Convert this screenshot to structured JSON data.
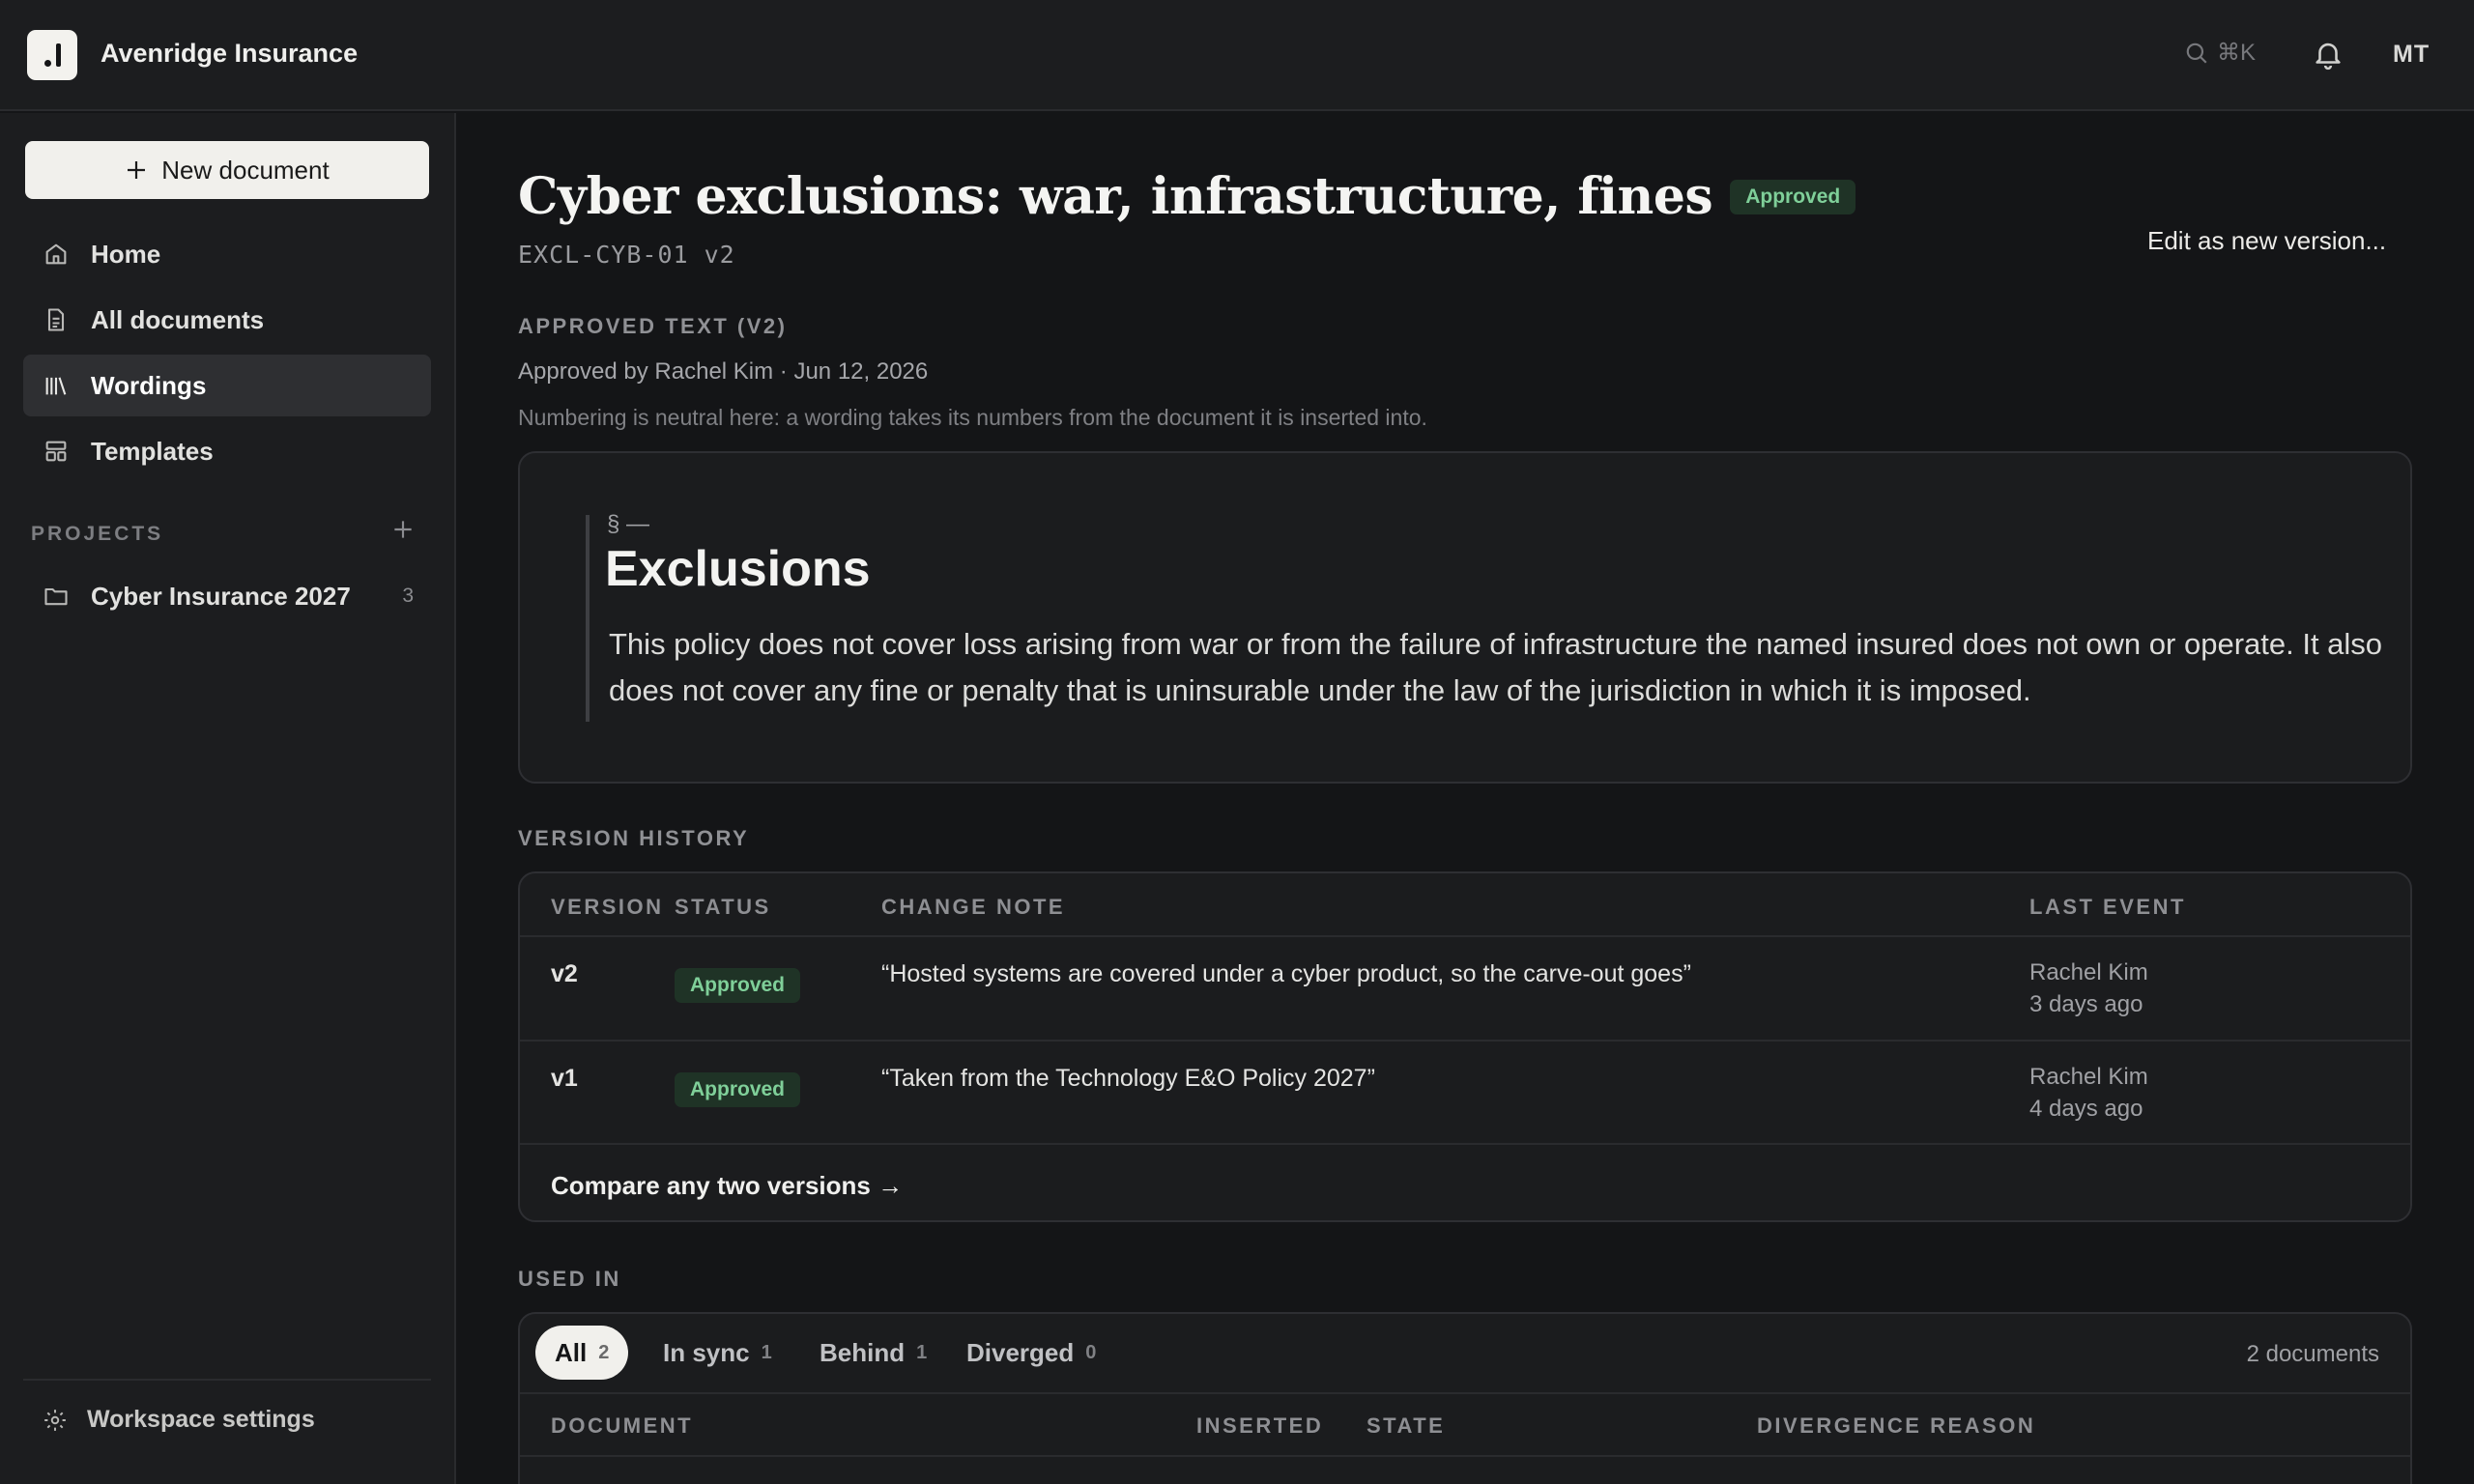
{
  "app": {
    "brand": "Avenridge Insurance",
    "search_shortcut": "⌘K",
    "user_initials": "MT"
  },
  "sidebar": {
    "new_doc_label": "New document",
    "items": [
      {
        "label": "Home",
        "icon": "home-icon"
      },
      {
        "label": "All documents",
        "icon": "document-icon"
      },
      {
        "label": "Wordings",
        "icon": "library-icon"
      },
      {
        "label": "Templates",
        "icon": "template-icon"
      }
    ],
    "projects_label": "PROJECTS",
    "projects": [
      {
        "label": "Cyber Insurance 2027",
        "count": "3"
      }
    ],
    "settings_label": "Workspace settings"
  },
  "page": {
    "title": "Cyber exclusions: war, infrastructure, fines",
    "status": "Approved",
    "doc_id": "EXCL-CYB-01 v2",
    "edit_label": "Edit as new version...",
    "approved_text_label": "APPROVED TEXT (V2)",
    "approved_by": "Approved by Rachel Kim · Jun 12, 2026",
    "numbering_note": "Numbering is neutral here: a wording takes its numbers from the document it is inserted into."
  },
  "wording": {
    "section_mark": "§ —",
    "heading": "Exclusions",
    "body": "This policy does not cover loss arising from war or from the failure of infrastructure the named insured does not own or operate. It also does not cover any fine or penalty that is uninsurable under the law of the jurisdiction in which it is imposed."
  },
  "history": {
    "label": "VERSION HISTORY",
    "columns": [
      "VERSION",
      "STATUS",
      "CHANGE NOTE",
      "LAST EVENT"
    ],
    "rows": [
      {
        "version": "v2",
        "status": "Approved",
        "note": "“Hosted systems are covered under a cyber product, so the carve-out goes”",
        "who": "Rachel Kim",
        "when": "3 days ago"
      },
      {
        "version": "v1",
        "status": "Approved",
        "note": "“Taken from the Technology E&O Policy 2027”",
        "who": "Rachel Kim",
        "when": "4 days ago"
      }
    ],
    "compare_label": "Compare any two versions →"
  },
  "used_in": {
    "label": "USED IN",
    "tabs": [
      {
        "label": "All",
        "count": "2"
      },
      {
        "label": "In sync",
        "count": "1"
      },
      {
        "label": "Behind",
        "count": "1"
      },
      {
        "label": "Diverged",
        "count": "0"
      }
    ],
    "docs_count": "2 documents",
    "columns": [
      "DOCUMENT",
      "INSERTED",
      "STATE",
      "DIVERGENCE REASON"
    ]
  }
}
